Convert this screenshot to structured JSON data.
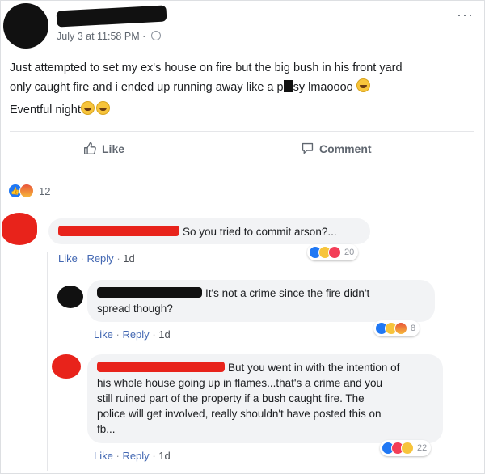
{
  "post": {
    "timestamp": "July 3 at 11:58 PM ·",
    "more": "···",
    "line1_a": "Just attempted to set my ex's house on fire but the big bush in his front yard",
    "line2_a": "only caught fire and i ended up running away like a p",
    "line2_b": "sy lmaoooo",
    "line3_a": "Eventful night"
  },
  "actions": {
    "like_label": "Like",
    "comment_label": "Comment"
  },
  "reactions": {
    "count": "12"
  },
  "comments": [
    {
      "text": "So you tried to commit arson?...",
      "like": "Like",
      "reply": "Reply",
      "age": "1d",
      "reaction_count": "20",
      "name_color": "#e8231b",
      "avatar_color": "#e8231b"
    },
    {
      "text1": "It's not a crime since the fire didn't",
      "text2": "spread though?",
      "like": "Like",
      "reply": "Reply",
      "age": "1d",
      "reaction_count": "8",
      "name_color": "#111111",
      "avatar_color": "#111111"
    },
    {
      "text1": "But you went in with the intention of",
      "text2": "his whole house going up in flames...that's a crime and you",
      "text3": "still ruined part of the property if a bush caught fire. The",
      "text4": "police will get involved, really shouldn't have posted this on",
      "text5": "fb...",
      "like": "Like",
      "reply": "Reply",
      "age": "1d",
      "reaction_count": "22",
      "name_color": "#e8231b",
      "avatar_color": "#e8231b"
    }
  ]
}
